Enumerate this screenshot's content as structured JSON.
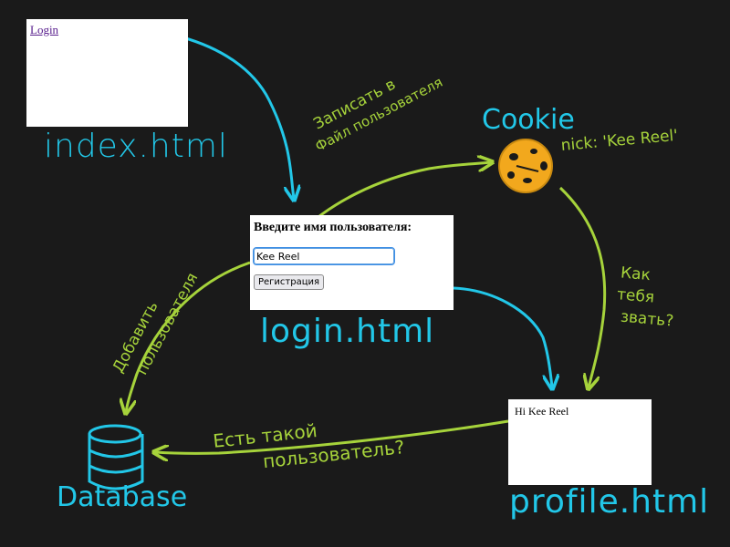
{
  "index_page": {
    "link": "Login",
    "label": "index.html"
  },
  "login_page": {
    "prompt": "Введите имя пользователя:",
    "input_value": "Kee Reel",
    "register_button": "Регистрация",
    "label": "login.html"
  },
  "profile_page": {
    "greeting": "Hi Kee Reel",
    "label": "profile.html"
  },
  "database": {
    "label": "Database",
    "icon": "database-icon"
  },
  "cookie": {
    "label": "Cookie",
    "value": "nick: 'Kee Reel'",
    "icon": "cookie-icon"
  },
  "annotations": {
    "write_line1": "Записать в",
    "write_line2": "Файл пользователя",
    "ask_line1": "Как",
    "ask_line2": "тебя",
    "ask_line3": "звать?",
    "add_line1": "Добавить",
    "add_line2": "пользователя",
    "exists_line1": "Есть такой",
    "exists_line2": "пользователь?"
  },
  "colors": {
    "background": "#1a1a1a",
    "cyan": "#22c7e8",
    "green": "#a6d33b",
    "cookie": "#f2a81d"
  }
}
